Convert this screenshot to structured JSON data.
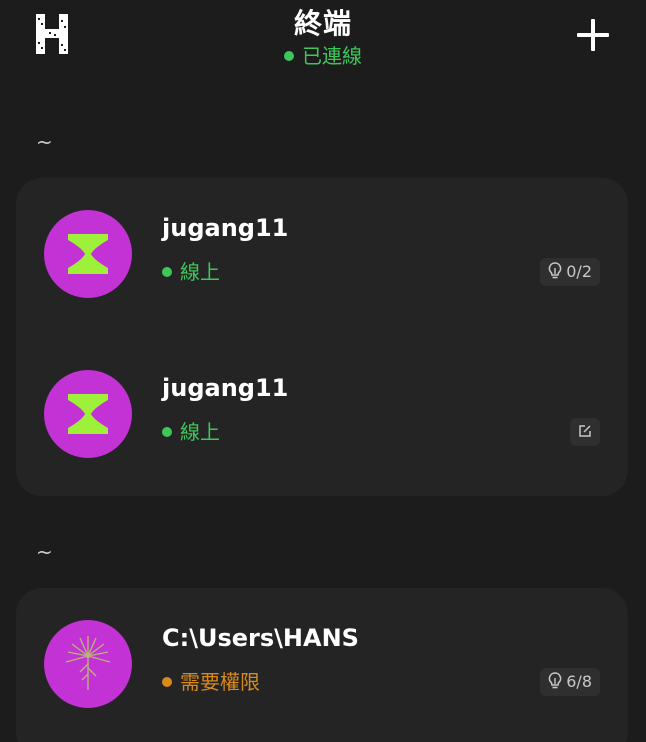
{
  "header": {
    "title": "終端",
    "connection_status": "已連線",
    "logo_icon": "h-logo-icon",
    "add_icon": "plus-icon"
  },
  "groups": [
    {
      "label": "~",
      "sessions": [
        {
          "name": "jugang11",
          "status": "線上",
          "status_color": "#3fc65a",
          "badge": "0/2",
          "badge_icon": "lightbulb-icon",
          "avatar_icon": "hourglass-icon"
        },
        {
          "name": "jugang11",
          "status": "線上",
          "status_color": "#3fc65a",
          "badge": "",
          "badge_icon": "edit-icon",
          "avatar_icon": "hourglass-icon"
        }
      ]
    },
    {
      "label": "~",
      "sessions": [
        {
          "name": "C:\\Users\\HANS",
          "status": "需要權限",
          "status_color": "#d98a1e",
          "badge": "6/8",
          "badge_icon": "lightbulb-icon",
          "avatar_icon": "dandelion-icon"
        }
      ]
    }
  ],
  "colors": {
    "background": "#1c1c1c",
    "card": "#242424",
    "online": "#3fc65a",
    "warning": "#d98a1e",
    "avatar_bg": "#c232d4",
    "avatar_accent": "#9ef03a"
  }
}
